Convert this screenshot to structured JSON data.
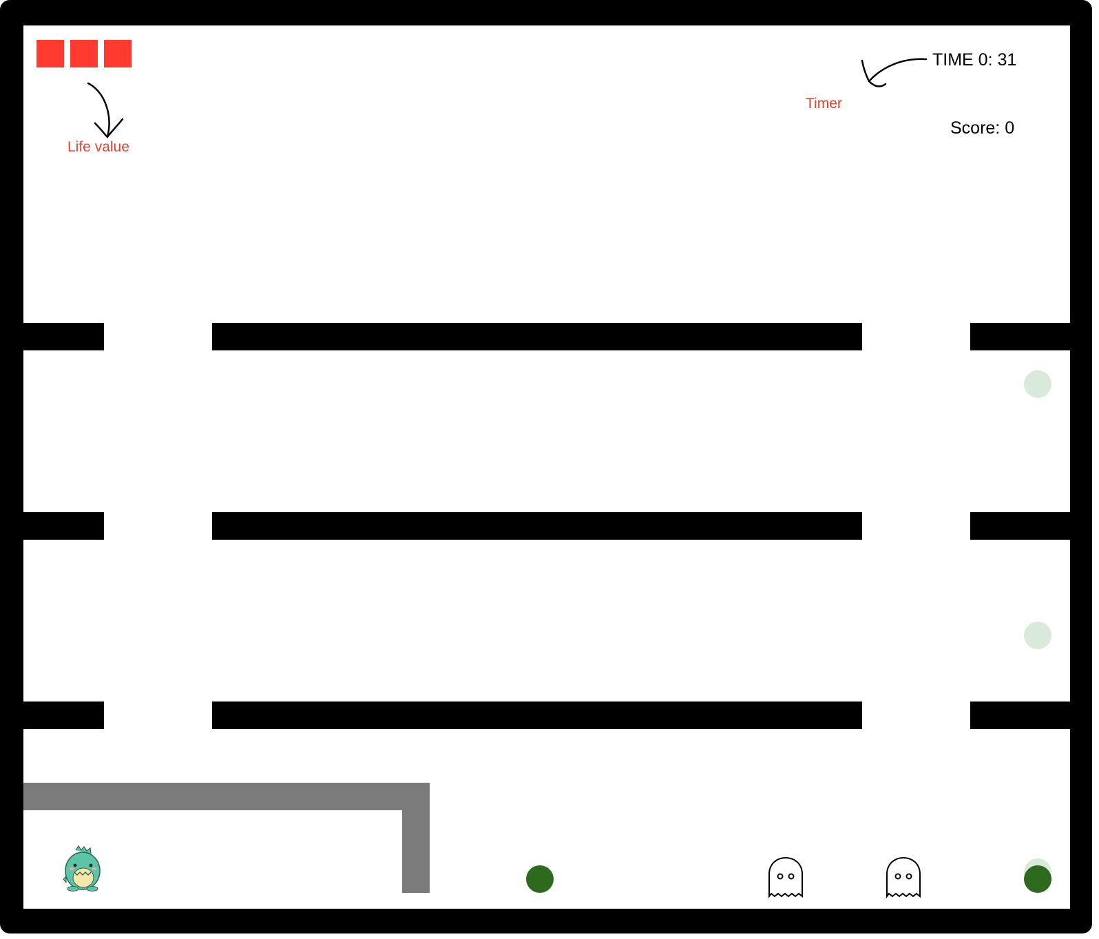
{
  "hud": {
    "lives": 3,
    "time_label": "TIME 0: 31",
    "score_label": "Score: 0"
  },
  "annotations": {
    "life_label": "Life value",
    "timer_label": "Timer"
  },
  "sprites": {
    "player": "dinosaur-player",
    "enemies": [
      "ghost-enemy",
      "ghost-enemy"
    ],
    "collectibles": {
      "active": 2,
      "faded": 3
    }
  },
  "colors": {
    "life": "#ff3b2f",
    "annotation": "#e8402e",
    "walls": "#000000",
    "pen": "#7b7b7b",
    "dot_active": "#2d6a1e",
    "dot_faded": "#d9eadb"
  }
}
